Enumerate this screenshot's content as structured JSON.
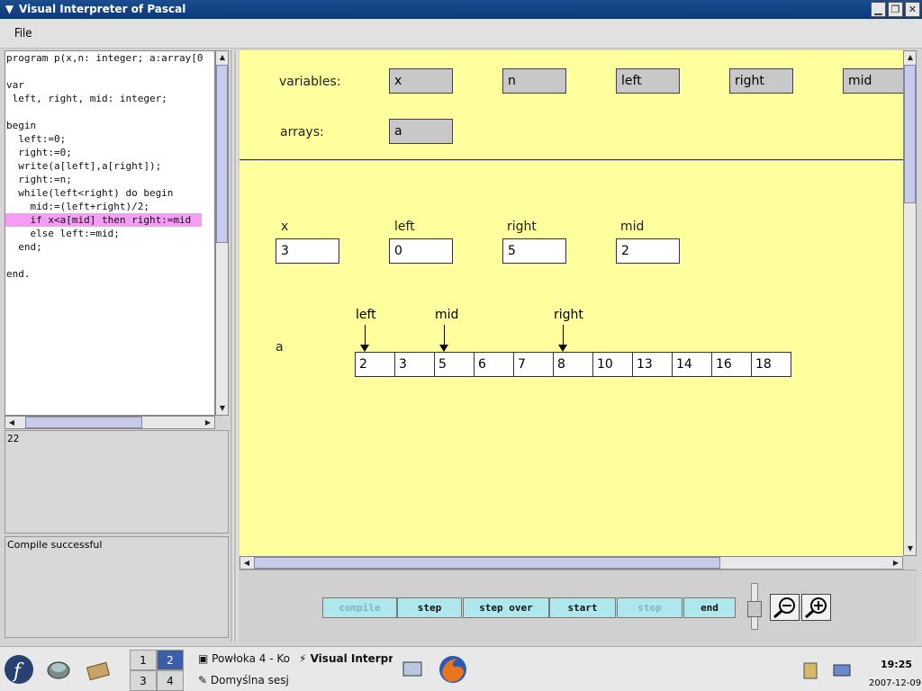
{
  "window": {
    "title": "Visual Interpreter of Pascal",
    "menu": [
      "File"
    ]
  },
  "code_lines": [
    "program p(x,n: integer; a:array[0",
    "",
    "var",
    " left, right, mid: integer;",
    "",
    "begin",
    "  left:=0;",
    "  right:=0;",
    "  write(a[left],a[right]);",
    "  right:=n;",
    "  while(left<right) do begin",
    "    mid:=(left+right)/2;",
    "    if x<a[mid] then right:=mid",
    "    else left:=mid;",
    "  end;",
    "",
    "end."
  ],
  "highlighted_line": 12,
  "output_text": "22",
  "status_text": "Compile successful",
  "variables": {
    "label": "variables:",
    "names": [
      "x",
      "n",
      "left",
      "right",
      "mid"
    ]
  },
  "arrays": {
    "label": "arrays:",
    "names": [
      "a"
    ]
  },
  "watched": [
    {
      "name": "x",
      "value": "3"
    },
    {
      "name": "left",
      "value": "0"
    },
    {
      "name": "right",
      "value": "5"
    },
    {
      "name": "mid",
      "value": "2"
    }
  ],
  "array_view": {
    "name": "a",
    "values": [
      "2",
      "3",
      "5",
      "6",
      "7",
      "8",
      "10",
      "13",
      "14",
      "16",
      "18"
    ],
    "pointers": [
      {
        "label": "left",
        "index": 0
      },
      {
        "label": "mid",
        "index": 2
      },
      {
        "label": "right",
        "index": 5
      }
    ]
  },
  "controls": [
    {
      "label": "compile",
      "enabled": false
    },
    {
      "label": "step",
      "enabled": true
    },
    {
      "label": "step over",
      "enabled": true
    },
    {
      "label": "start",
      "enabled": true
    },
    {
      "label": "stop",
      "enabled": false
    },
    {
      "label": "end",
      "enabled": true
    }
  ],
  "taskbar": {
    "workspaces": [
      "1",
      "2",
      "3",
      "4"
    ],
    "tasks": [
      "Powłoka 4 - Ko",
      "Visual Interpr",
      "Domyślna sesj"
    ],
    "time": "19:25",
    "date": "2007-12-09"
  }
}
